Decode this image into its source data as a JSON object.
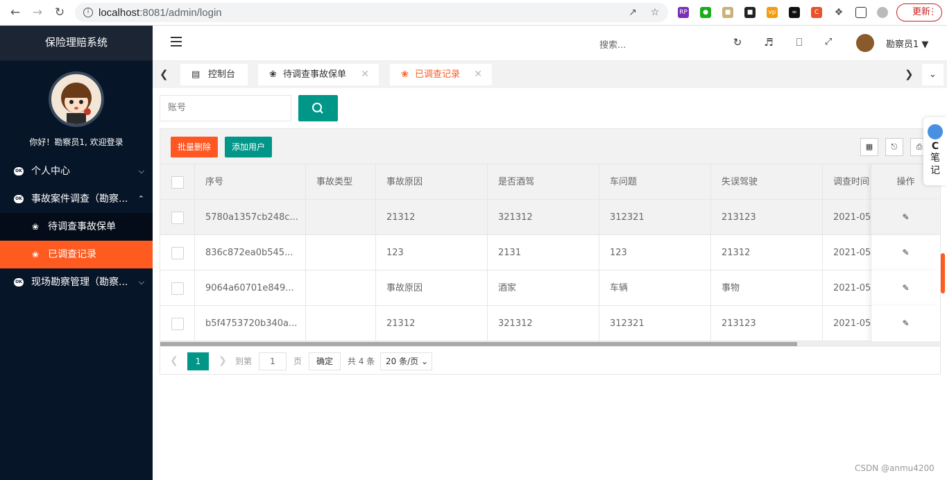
{
  "browser": {
    "url_host": "localhost",
    "url_path": ":8081/admin/login",
    "update_label": "更新"
  },
  "sidebar": {
    "brand": "保险理赔系统",
    "welcome": "你好！勘察员1, 欢迎登录",
    "items": [
      {
        "label": "个人中心"
      },
      {
        "label": "事故案件调查（勘察..."
      },
      {
        "label": "现场勘察管理（勘察..."
      }
    ],
    "subitems": [
      {
        "label": "待调查事故保单"
      },
      {
        "label": "已调查记录"
      }
    ]
  },
  "header": {
    "search_placeholder": "搜索...",
    "user": "勘察员1"
  },
  "tabs": [
    {
      "label": "控制台"
    },
    {
      "label": "待调查事故保单"
    },
    {
      "label": "已调查记录"
    }
  ],
  "search": {
    "account_placeholder": "账号"
  },
  "toolbar": {
    "batch_delete": "批量删除",
    "add_user": "添加用户"
  },
  "table": {
    "headers": [
      "序号",
      "事故类型",
      "事故原因",
      "是否酒驾",
      "车问题",
      "失误驾驶",
      "调查时间",
      "操作"
    ],
    "rows": [
      [
        "5780a1357cb248c...",
        "",
        "21312",
        "321312",
        "312321",
        "213123",
        "2021-05"
      ],
      [
        "836c872ea0b545...",
        "",
        "123",
        "2131",
        "123",
        "21312",
        "2021-05"
      ],
      [
        "9064a60701e849...",
        "",
        "事故原因",
        "酒家",
        "车辆",
        "事物",
        "2021-05"
      ],
      [
        "b5f4753720b340a...",
        "",
        "21312",
        "321312",
        "312321",
        "213123",
        "2021-05"
      ]
    ]
  },
  "pager": {
    "current": "1",
    "goto_label": "到第",
    "goto_value": "1",
    "page_unit": "页",
    "confirm": "确定",
    "total": "共 4 条",
    "per_page": "20 条/页"
  },
  "side_note": {
    "c": "C",
    "line1": "笔",
    "line2": "记"
  },
  "watermark": "CSDN @anmu4200",
  "colors": {
    "primary": "#009688",
    "accent": "#ff5a1f",
    "sidebar": "#071528"
  }
}
